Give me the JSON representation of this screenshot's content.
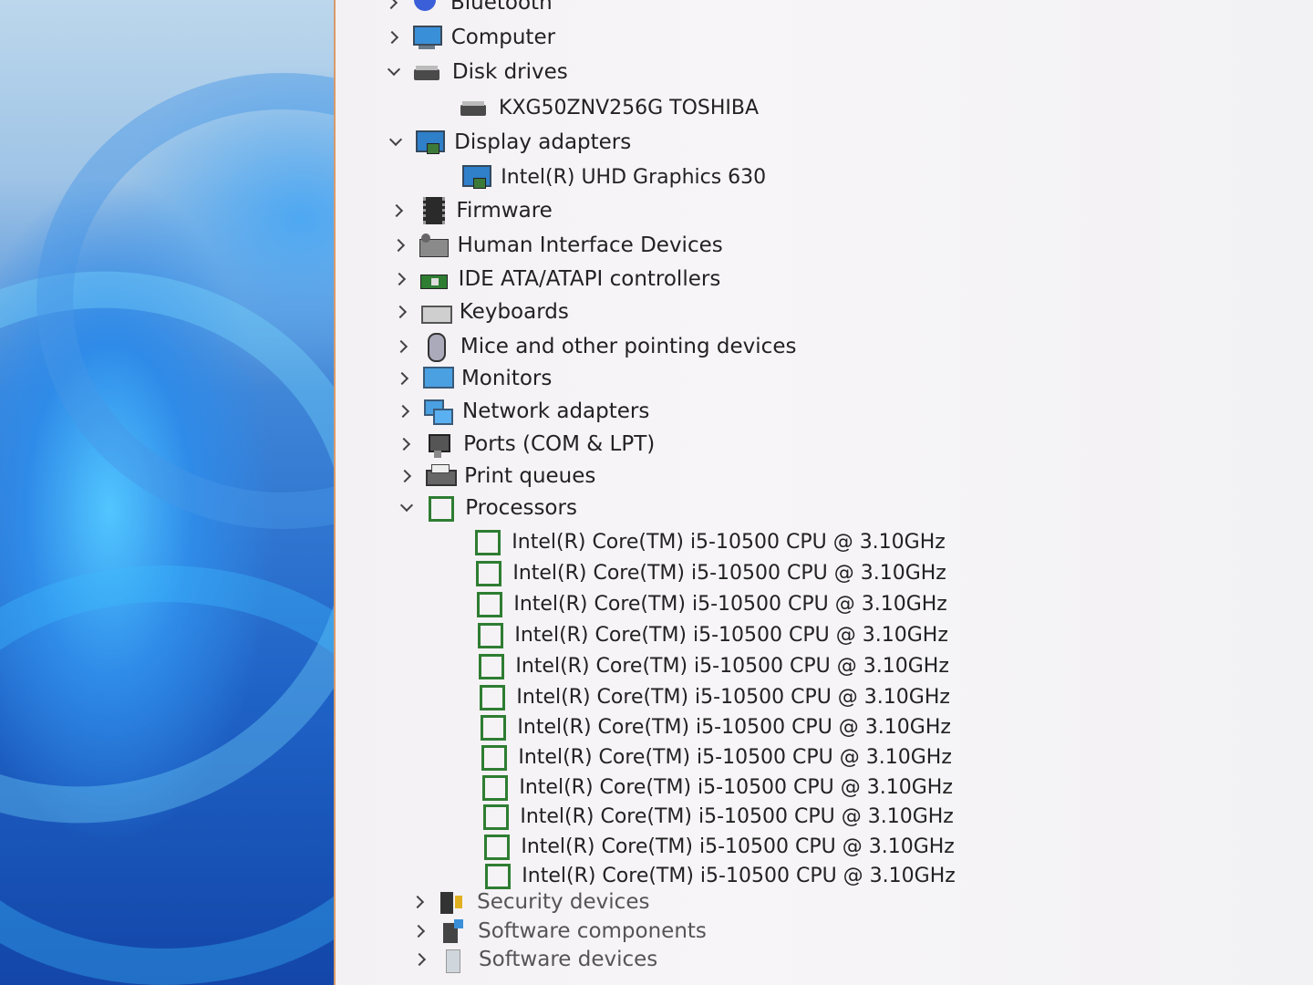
{
  "categories": [
    {
      "key": "bluetooth",
      "label": "Bluetooth",
      "expanded": false,
      "icon": "bluetooth-icon"
    },
    {
      "key": "computer",
      "label": "Computer",
      "expanded": false,
      "icon": "computer-icon"
    },
    {
      "key": "disk",
      "label": "Disk drives",
      "expanded": true,
      "icon": "disk-drive-icon",
      "children": [
        "KXG50ZNV256G TOSHIBA"
      ]
    },
    {
      "key": "display",
      "label": "Display adapters",
      "expanded": true,
      "icon": "display-adapter-icon",
      "children": [
        "Intel(R) UHD Graphics 630"
      ]
    },
    {
      "key": "firmware",
      "label": "Firmware",
      "expanded": false,
      "icon": "firmware-icon"
    },
    {
      "key": "hid",
      "label": "Human Interface Devices",
      "expanded": false,
      "icon": "hid-icon"
    },
    {
      "key": "ide",
      "label": "IDE ATA/ATAPI controllers",
      "expanded": false,
      "icon": "ide-controller-icon"
    },
    {
      "key": "keyboards",
      "label": "Keyboards",
      "expanded": false,
      "icon": "keyboard-icon"
    },
    {
      "key": "mice",
      "label": "Mice and other pointing devices",
      "expanded": false,
      "icon": "mouse-icon"
    },
    {
      "key": "monitors",
      "label": "Monitors",
      "expanded": false,
      "icon": "monitor-icon"
    },
    {
      "key": "network",
      "label": "Network adapters",
      "expanded": false,
      "icon": "network-adapter-icon"
    },
    {
      "key": "ports",
      "label": "Ports (COM & LPT)",
      "expanded": false,
      "icon": "port-icon"
    },
    {
      "key": "print",
      "label": "Print queues",
      "expanded": false,
      "icon": "printer-icon"
    },
    {
      "key": "processors",
      "label": "Processors",
      "expanded": true,
      "icon": "processor-icon",
      "children": [
        "Intel(R) Core(TM) i5-10500 CPU @ 3.10GHz",
        "Intel(R) Core(TM) i5-10500 CPU @ 3.10GHz",
        "Intel(R) Core(TM) i5-10500 CPU @ 3.10GHz",
        "Intel(R) Core(TM) i5-10500 CPU @ 3.10GHz",
        "Intel(R) Core(TM) i5-10500 CPU @ 3.10GHz",
        "Intel(R) Core(TM) i5-10500 CPU @ 3.10GHz",
        "Intel(R) Core(TM) i5-10500 CPU @ 3.10GHz",
        "Intel(R) Core(TM) i5-10500 CPU @ 3.10GHz",
        "Intel(R) Core(TM) i5-10500 CPU @ 3.10GHz",
        "Intel(R) Core(TM) i5-10500 CPU @ 3.10GHz",
        "Intel(R) Core(TM) i5-10500 CPU @ 3.10GHz",
        "Intel(R) Core(TM) i5-10500 CPU @ 3.10GHz"
      ]
    },
    {
      "key": "security",
      "label": "Security devices",
      "expanded": false,
      "icon": "security-device-icon"
    },
    {
      "key": "softcomp",
      "label": "Software components",
      "expanded": false,
      "icon": "software-component-icon"
    },
    {
      "key": "softdev",
      "label": "Software devices",
      "expanded": false,
      "icon": "software-device-icon"
    }
  ]
}
